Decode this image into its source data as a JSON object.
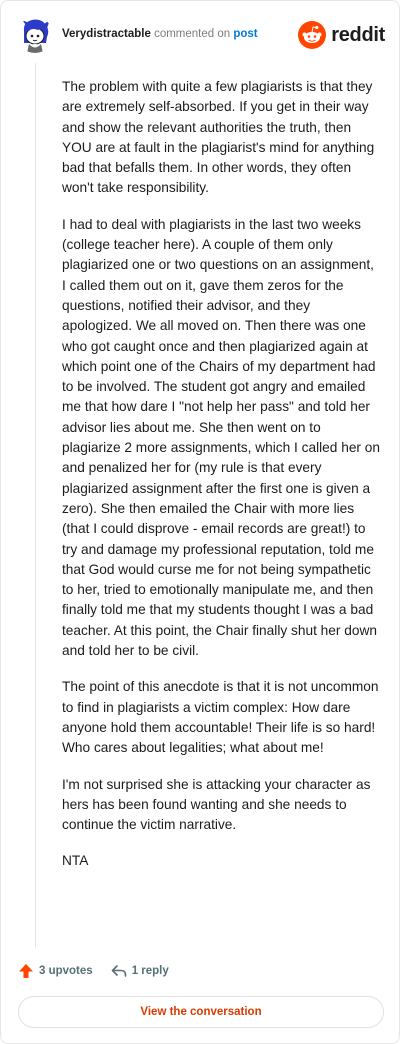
{
  "header": {
    "username": "Verydistractable",
    "commented_on": "commented on",
    "post_link": "post",
    "brand": "reddit",
    "avatar_icon": "snoo-avatar-icon",
    "brand_icon": "reddit-logo-icon"
  },
  "comment": {
    "paragraphs": [
      "The problem with quite a few plagiarists is that they are extremely self-absorbed. If you get in their way and show the relevant authorities the truth, then YOU are at fault in the plagiarist's mind for anything bad that befalls them. In other words, they often won't take responsibility.",
      "I had to deal with plagiarists in the last two weeks (college teacher here). A couple of them only plagiarized one or two questions on an assignment, I called them out on it, gave them zeros for the questions, notified their advisor, and they apologized. We all moved on. Then there was one who got caught once and then plagiarized again at which point one of the Chairs of my department had to be involved. The student got angry and emailed me that how dare I \"not help her pass\" and told her advisor lies about me. She then went on to plagiarize 2 more assignments, which I called her on and penalized her for (my rule is that every plagiarized assignment after the first one is given a zero). She then emailed the Chair with more lies (that I could disprove - email records are great!) to try and damage my professional reputation, told me that God would curse me for not being sympathetic to her, tried to emotionally manipulate me, and then finally told me that my students thought I was a bad teacher. At this point, the Chair finally shut her down and told her to be civil.",
      "The point of this anecdote is that it is not uncommon to find in plagiarists a victim complex: How dare anyone hold them accountable! Their life is so hard! Who cares about legalities; what about me!",
      "I'm not surprised she is attacking your character as hers has been found wanting and she needs to continue the victim narrative.",
      "NTA"
    ]
  },
  "actions": {
    "upvotes": "3 upvotes",
    "replies": "1 reply",
    "upvote_icon": "upvote-arrow-icon",
    "reply_icon": "reply-arrow-icon"
  },
  "footer": {
    "view_conversation": "View the conversation"
  },
  "colors": {
    "accent": "#ff4500",
    "link": "#0079d3",
    "button_text": "#d93a00",
    "muted": "#7c7c7c"
  }
}
